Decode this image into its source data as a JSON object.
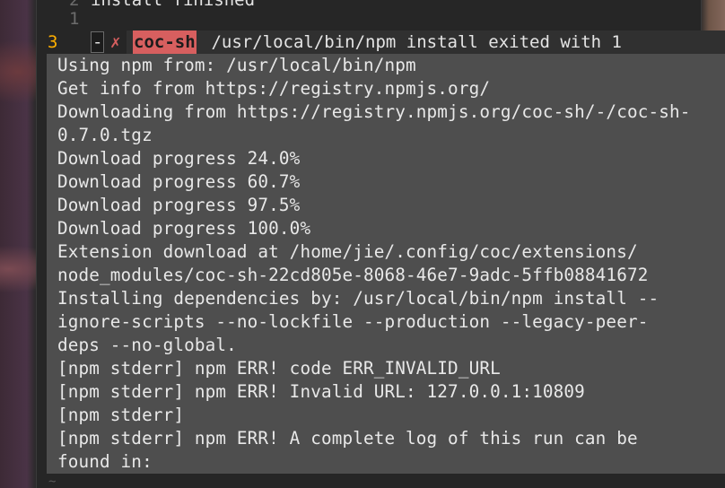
{
  "editor": {
    "top_line_num": "2",
    "top_line_text": "install finished",
    "relative_line_num": "1",
    "current_line_num": "3",
    "sign": "-",
    "error_mark": "✗",
    "ext_name": "coc-sh",
    "message": " /usr/local/bin/npm install exited with 1",
    "tilde": "~"
  },
  "popup": {
    "lines": [
      "Using npm from: /usr/local/bin/npm",
      "Get info from https://registry.npmjs.org/",
      "Downloading from https://registry.npmjs.org/coc-sh/-/coc-sh-",
      "0.7.0.tgz",
      "Download progress 24.0%",
      "Download progress 60.7%",
      "Download progress 97.5%",
      "Download progress 100.0%",
      "Extension download at /home/jie/.config/coc/extensions/",
      "node_modules/coc-sh-22cd805e-8068-46e7-9adc-5ffb08841672",
      "Installing dependencies by: /usr/local/bin/npm install --",
      "ignore-scripts --no-lockfile --production --legacy-peer-",
      "deps --no-global.",
      "[npm stderr] npm ERR! code ERR_INVALID_URL",
      "[npm stderr] npm ERR! Invalid URL: 127.0.0.1:10809",
      "[npm stderr]",
      "[npm stderr] npm ERR! A complete log of this run can be",
      "found in:"
    ]
  },
  "colors": {
    "ext_name_bg": "#d75f5f",
    "error_mark": "#d75f5f",
    "current_line_num": "#ffaf00",
    "popup_bg": "#4e4e4e"
  }
}
